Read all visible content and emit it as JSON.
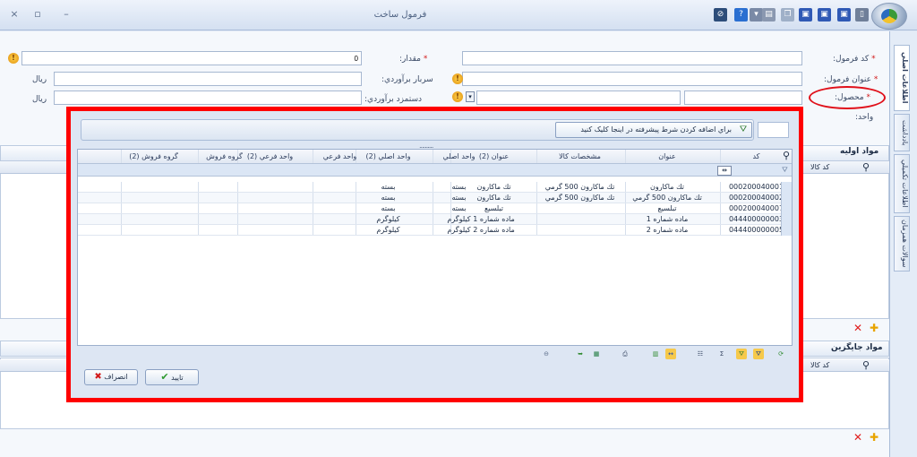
{
  "window": {
    "title": "فرمول ساخت",
    "close_glyph": "×",
    "restore_glyph": "▫",
    "minimize_glyph": "–"
  },
  "toolbar": {
    "icons": [
      {
        "name": "about-icon",
        "glyph": "⊘",
        "color": "#2d4d7a"
      },
      {
        "name": "help-icon",
        "glyph": "?",
        "color": "#2a6fd1"
      },
      {
        "name": "more-icon",
        "glyph": "▾",
        "color": "#7a8aa6"
      },
      {
        "name": "print-icon",
        "glyph": "▤",
        "color": "#8a98b0"
      },
      {
        "name": "copy-icon",
        "glyph": "❐",
        "color": "#9fb0c8"
      },
      {
        "name": "save-close-icon",
        "glyph": "▣",
        "color": "#2f59b5"
      },
      {
        "name": "save-new-icon",
        "glyph": "▣",
        "color": "#2f59b5"
      },
      {
        "name": "save-icon",
        "glyph": "▣",
        "color": "#2f59b5"
      },
      {
        "name": "new-icon",
        "glyph": "▯",
        "color": "#6f7f99"
      }
    ]
  },
  "form": {
    "formula_code": {
      "label": "کد فرمول:",
      "star": "*",
      "value": ""
    },
    "formula_title": {
      "label": "عنوان فرمول:",
      "star": "*",
      "value": ""
    },
    "product": {
      "label": "محصول:",
      "star": "*",
      "value": ""
    },
    "unit": {
      "label": "واحد:",
      "value": ""
    },
    "quantity": {
      "label": "مقدار:",
      "star": "*",
      "value": "0"
    },
    "overhead": {
      "label": "سربار برآوردي:",
      "value": "",
      "currency": "ريال"
    },
    "wage": {
      "label": "دستمزد برآوردي:",
      "value": "",
      "currency": "ريال"
    }
  },
  "side_tabs": [
    "اطلاعات اصلي",
    "بادداشت",
    "اطلاعات تکميلي",
    "سوالات همزمان"
  ],
  "sections": {
    "primary_materials": {
      "title": "مواد اوليه",
      "col_code": "کد کالا"
    },
    "substitute_materials": {
      "title": "مواد جايگزين",
      "col_code": "کد کالا"
    }
  },
  "dialog": {
    "filter_hint": "براي اضافه کردن شرط پيشرفته در اينجا کليک کنيد",
    "grip": "..........",
    "columns": [
      "کد",
      "عنوان",
      "مشخصات کالا",
      "عنوان (2)",
      "واحد اصلي",
      "واحد اصلي (2)",
      "واحد فرعي",
      "واحد فرعي (2)",
      "گروه فروش",
      "گروه فروش (2)"
    ],
    "rows": [
      [
        "000200040001",
        "تك ماكارون",
        "تك ماكارون 500 گرمي",
        "تك ماكارون",
        "بسته",
        "بسته",
        "",
        "",
        "",
        ""
      ],
      [
        "000200040002",
        "تك ماكارون 500 گرمي",
        "تك ماكارون 500 گرمي",
        "تك ماكارون",
        "بسته",
        "بسته",
        "",
        "",
        "",
        ""
      ],
      [
        "000200040007",
        "تبلسيع",
        "",
        "تبلسيع",
        "بسته",
        "بسته",
        "",
        "",
        "",
        ""
      ],
      [
        "044400000003",
        "ماده شماره 1",
        "",
        "ماده شماره 1",
        "كيلوگرم",
        "كيلوگرم",
        "",
        "",
        "",
        ""
      ],
      [
        "044400000005",
        "ماده شماره 2",
        "",
        "ماده شماره 2",
        "كيلوگرم",
        "كيلوگرم",
        "",
        "",
        "",
        ""
      ]
    ],
    "confirm_label": "تاييد",
    "cancel_label": "انصراف",
    "frame_color": "#ff0000"
  },
  "annotation": {
    "color": "#e0101a"
  }
}
